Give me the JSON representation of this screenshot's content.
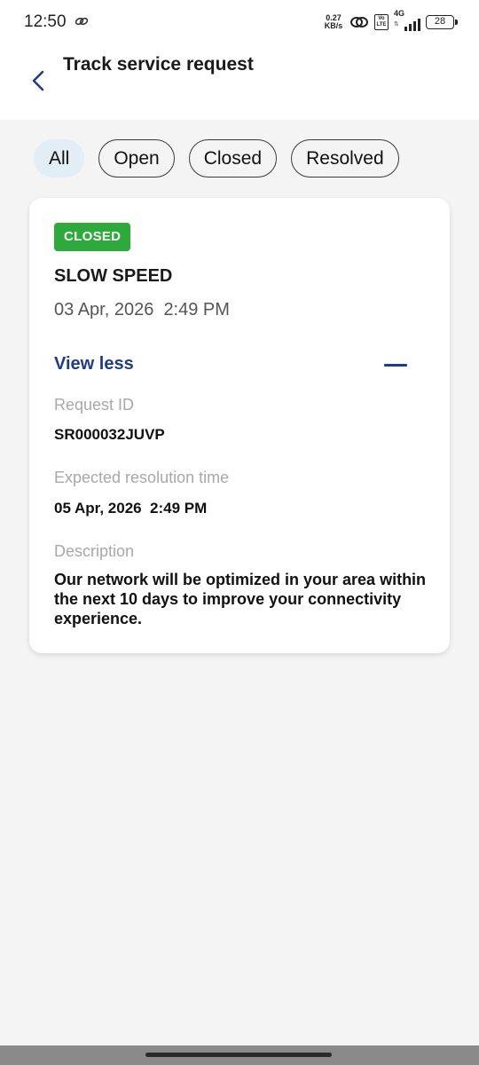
{
  "status_bar": {
    "time": "12:50",
    "net_speed_value": "0.27",
    "net_speed_unit": "KB/s",
    "volte_top": "Vo",
    "volte_bottom": "LTE",
    "network": "4G",
    "battery": "28"
  },
  "header": {
    "title": "Track service request"
  },
  "filters": [
    {
      "label": "All",
      "active": true
    },
    {
      "label": "Open",
      "active": false
    },
    {
      "label": "Closed",
      "active": false
    },
    {
      "label": "Resolved",
      "active": false
    }
  ],
  "card": {
    "status_badge": "CLOSED",
    "status_color": "#2eaa3a",
    "title": "SLOW SPEED",
    "date": "03 Apr, 2026  2:49 PM",
    "toggle_label": "View less",
    "request_id_label": "Request ID",
    "request_id": "SR000032JUVP",
    "resolution_label": "Expected resolution time",
    "resolution_time": "05 Apr, 2026  2:49 PM",
    "description_label": "Description",
    "description": "Our network will be optimized in your area within the next 10 days to improve your connectivity experience."
  },
  "colors": {
    "accent": "#1d3c8a",
    "active_chip_bg": "#e3edf6",
    "page_bg": "#f4f4f4"
  }
}
